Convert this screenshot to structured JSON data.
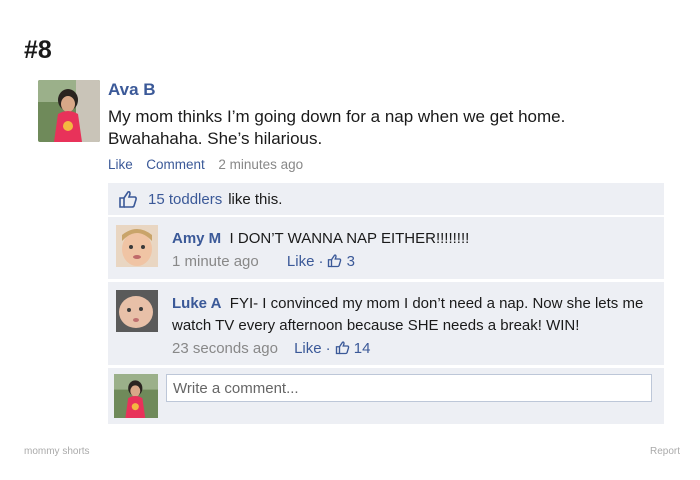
{
  "page_number": "#8",
  "post": {
    "author": "Ava B",
    "text": "My mom thinks I’m going down for a nap when we get home. Bwahahaha. She’s hilarious.",
    "like_label": "Like",
    "comment_label": "Comment",
    "timestamp": "2 minutes ago"
  },
  "likes": {
    "count_text": "15 toddlers",
    "suffix": "like this."
  },
  "comments": [
    {
      "author": "Amy M",
      "text": "I DON’T WANNA NAP EITHER!!!!!!!!",
      "timestamp": "1 minute ago",
      "like_label": "Like",
      "like_count": "3"
    },
    {
      "author": "Luke A",
      "text": "FYI- I convinced my mom I don’t need a nap. Now she lets me watch TV every afternoon because SHE needs a break! WIN!",
      "timestamp": "23 seconds ago",
      "like_label": "Like",
      "like_count": "14"
    }
  ],
  "write_comment": {
    "placeholder": "Write a comment..."
  },
  "footer": {
    "left": "mommy shorts",
    "right": "Report"
  },
  "colors": {
    "link": "#3b5998",
    "panel": "#edeff4"
  }
}
